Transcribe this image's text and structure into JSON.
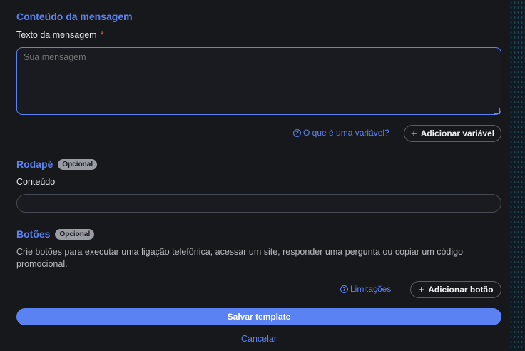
{
  "message": {
    "title": "Conteúdo da mensagem",
    "text_label": "Texto da mensagem",
    "required_mark": "*",
    "placeholder": "Sua mensagem",
    "value": "",
    "help_link": "O que é uma variável?",
    "add_variable": "Adicionar variável"
  },
  "footer": {
    "title": "Rodapé",
    "badge": "Opcional",
    "content_label": "Conteúdo",
    "value": ""
  },
  "buttons": {
    "title": "Botões",
    "badge": "Opcional",
    "description": "Crie botões para executar uma ligação telefônica, acessar um site, responder uma pergunta ou copiar um código promocional.",
    "help_link": "Limitações",
    "add_button": "Adicionar botão"
  },
  "actions": {
    "save": "Salvar template",
    "cancel": "Cancelar"
  },
  "icons": {
    "help": "help-circle-icon",
    "plus": "plus-icon"
  },
  "colors": {
    "accent": "#5b82f2",
    "background": "#17181c",
    "required": "#ef5a5a"
  }
}
